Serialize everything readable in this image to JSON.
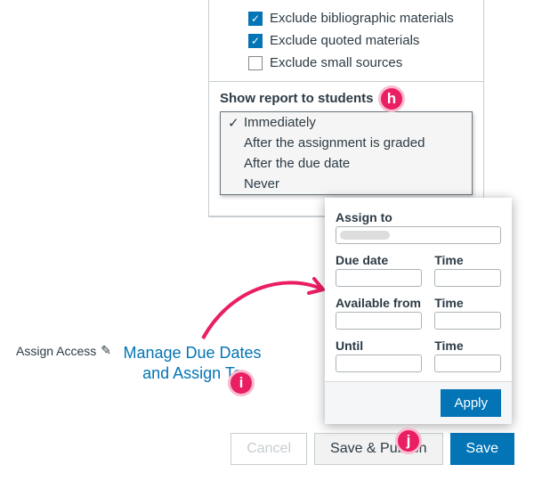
{
  "exclude": {
    "biblio": {
      "label": "Exclude bibliographic materials",
      "checked": true
    },
    "quoted": {
      "label": "Exclude quoted materials",
      "checked": true
    },
    "small": {
      "label": "Exclude small sources",
      "checked": false
    }
  },
  "showReport": {
    "label": "Show report to students",
    "options": [
      "Immediately",
      "After the assignment is graded",
      "After the due date",
      "Never"
    ],
    "selectedIndex": 0
  },
  "assignAccess": {
    "label": "Assign Access"
  },
  "manageLink": {
    "text": "Manage Due Dates and Assign To"
  },
  "popover": {
    "assignTo": "Assign to",
    "dueDate": "Due date",
    "time": "Time",
    "availableFrom": "Available from",
    "until": "Until",
    "apply": "Apply"
  },
  "footer": {
    "cancel": "Cancel",
    "savePublish": "Save & Publish",
    "save": "Save"
  },
  "callouts": {
    "h": "h",
    "i": "i",
    "j": "j"
  },
  "colors": {
    "accent": "#0374b5",
    "callout": "#e91e63"
  }
}
